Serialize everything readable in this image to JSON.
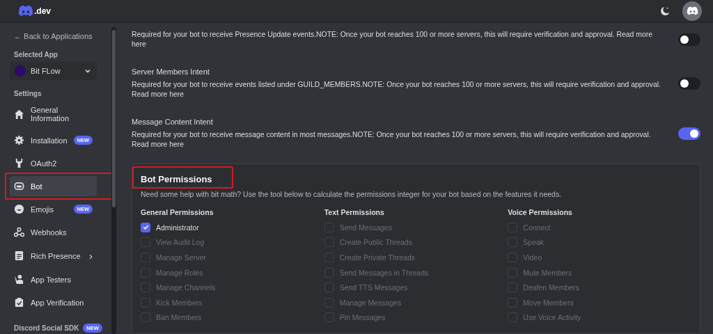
{
  "header": {
    "logo_text": ".dev"
  },
  "sidebar": {
    "back_link": "← Back to Applications",
    "selected_app_label": "Selected App",
    "app_name": "Bit FLow",
    "settings_label": "Settings",
    "items": [
      {
        "label": "General Information",
        "selected": false,
        "highlighted": false
      },
      {
        "label": "Installation",
        "badge": "NEW",
        "selected": false,
        "highlighted": false
      },
      {
        "label": "OAuth2",
        "selected": false,
        "highlighted": false
      },
      {
        "label": "Bot",
        "selected": true,
        "highlighted": true
      },
      {
        "label": "Emojis",
        "badge": "NEW",
        "selected": false,
        "highlighted": false
      },
      {
        "label": "Webhooks",
        "selected": false,
        "highlighted": false
      },
      {
        "label": "Rich Presence",
        "chevron": "›",
        "selected": false,
        "highlighted": false
      },
      {
        "label": "App Testers",
        "selected": false,
        "highlighted": false
      },
      {
        "label": "App Verification",
        "selected": false,
        "highlighted": false
      }
    ],
    "section_cut": {
      "label": "Discord Social SDK",
      "badge": "NEW"
    }
  },
  "intents": [
    {
      "description": "Required for your bot to receive Presence Update events.NOTE: Once your bot reaches 100 or more servers, this will require verification and approval. Read more here",
      "on": false
    },
    {
      "title": "Server Members Intent",
      "description": "Required for your bot to receive events listed under GUILD_MEMBERS.NOTE: Once your bot reaches 100 or more servers, this will require verification and approval. Read more here",
      "on": false
    },
    {
      "title": "Message Content Intent",
      "description": "Required for your bot to receive message content in most messages.NOTE: Once your bot reaches 100 or more servers, this will require verification and approval. Read more here",
      "on": true
    }
  ],
  "permissions": {
    "title": "Bot Permissions",
    "highlighted": true,
    "description": "Need some help with bit math? Use the tool below to calculate the permissions integer for your bot based on the features it needs.",
    "columns": [
      {
        "heading": "General Permissions",
        "items": [
          {
            "label": "Administrator",
            "checked": true,
            "disabled": false
          },
          {
            "label": "View Audit Log",
            "checked": false,
            "disabled": true
          },
          {
            "label": "Manage Server",
            "checked": false,
            "disabled": true
          },
          {
            "label": "Manage Roles",
            "checked": false,
            "disabled": true
          },
          {
            "label": "Manage Channels",
            "checked": false,
            "disabled": true
          },
          {
            "label": "Kick Members",
            "checked": false,
            "disabled": true
          },
          {
            "label": "Ban Members",
            "checked": false,
            "disabled": true
          }
        ]
      },
      {
        "heading": "Text Permissions",
        "items": [
          {
            "label": "Send Messages",
            "checked": false,
            "disabled": true
          },
          {
            "label": "Create Public Threads",
            "checked": false,
            "disabled": true
          },
          {
            "label": "Create Private Threads",
            "checked": false,
            "disabled": true
          },
          {
            "label": "Send Messages in Threads",
            "checked": false,
            "disabled": true
          },
          {
            "label": "Send TTS Messages",
            "checked": false,
            "disabled": true
          },
          {
            "label": "Manage Messages",
            "checked": false,
            "disabled": true
          },
          {
            "label": "Pin Messages",
            "checked": false,
            "disabled": true
          }
        ]
      },
      {
        "heading": "Voice Permissions",
        "items": [
          {
            "label": "Connect",
            "checked": false,
            "disabled": true
          },
          {
            "label": "Speak",
            "checked": false,
            "disabled": true
          },
          {
            "label": "Video",
            "checked": false,
            "disabled": true
          },
          {
            "label": "Mute Members",
            "checked": false,
            "disabled": true
          },
          {
            "label": "Deafen Members",
            "checked": false,
            "disabled": true
          },
          {
            "label": "Move Members",
            "checked": false,
            "disabled": true
          },
          {
            "label": "Use Voice Activity",
            "checked": false,
            "disabled": true
          }
        ]
      }
    ]
  }
}
